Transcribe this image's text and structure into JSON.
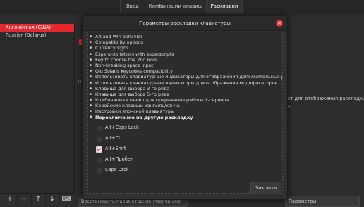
{
  "tabs": [
    "Ввод",
    "Комбинации клавиш",
    "Раскладки"
  ],
  "languages": [
    "Английская (США)",
    "Russian (Belarus)"
  ],
  "toolbar": {
    "add": "+",
    "remove": "−",
    "up": "↑",
    "down": "↓",
    "keyboard": "⌨"
  },
  "background": {
    "right_text_1": "кст для отображения раскладки",
    "right_text_2": "ст",
    "left_p": "П",
    "restore_button": "Восстановить параметры по умолчанию",
    "params_button": "Параметры"
  },
  "dialog": {
    "title": "Параметры раскладки клавиатуры",
    "close_icon": "×",
    "groups": [
      "Alt and Win behavior",
      "Compatibility options",
      "Currency signs",
      "Esperanto letters with superscripts",
      "Key to choose the 2nd level",
      "Non-breaking space input",
      "Old Solaris keycodes compatibility",
      "Использовать клавиатурные индикаторы для отображения дополнительных ра",
      "Использовать клавиатурные индикаторы для отображения модификаторов",
      "Клавиша для выбора 3-го ряда",
      "Клавиша для выбора 5-го ряда",
      "Комбинация клавиш для прерывания работы X-сервера",
      "Корейские клавиши хангыль/ханча",
      "Настройки японской клавиатуры"
    ],
    "expanded_group": "Переключение на другую раскладку",
    "options": [
      {
        "label": "Alt+Caps Lock",
        "checked": false
      },
      {
        "label": "Alt+Ctrl",
        "checked": false
      },
      {
        "label": "Alt+Shift",
        "checked": true
      },
      {
        "label": "Alt+Пробел",
        "checked": false
      },
      {
        "label": "Caps Lock",
        "checked": false
      }
    ],
    "close_button": "Закрыть"
  },
  "colors": {
    "accent": "#e5282d",
    "bg": "#2d2d2d"
  }
}
